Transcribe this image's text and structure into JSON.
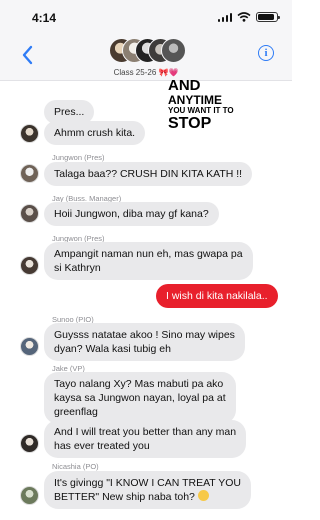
{
  "status_bar": {
    "time": "4:14"
  },
  "header": {
    "group_name": "Class 25-26",
    "group_emoji": "🎀💗",
    "back_icon": "chevron-left-icon",
    "info_icon": "info-icon",
    "info_glyph": "i"
  },
  "sticker": {
    "line1": "AND",
    "line2": "ANYTIME",
    "line3": "YOU WANT IT TO",
    "line4": "STOP"
  },
  "messages": [
    {
      "sender": "",
      "text": "Pres...",
      "direction": "in"
    },
    {
      "sender": "",
      "text": "Ahmm crush kita.",
      "direction": "in"
    },
    {
      "sender": "Jungwon (Pres)",
      "text": "Talaga baa?? CRUSH DIN KITA KATH !!",
      "direction": "in"
    },
    {
      "sender": "Jay (Buss. Manager)",
      "text": "Hoii Jungwon, diba may gf kana?",
      "direction": "in"
    },
    {
      "sender": "Jungwon (Pres)",
      "text_lines": [
        "Ampangit naman nun eh, mas gwapa pa",
        "si Kathryn"
      ],
      "direction": "in"
    },
    {
      "sender": "",
      "text": "I wish di kita nakilala..",
      "direction": "out"
    },
    {
      "sender": "Sunoo (PIO)",
      "text_lines": [
        "Guysss natatae akoo ! Sino may wipes",
        "dyan? Wala kasi tubig eh"
      ],
      "direction": "in"
    },
    {
      "sender": "Jake (VP)",
      "text_lines": [
        "Tayo nalang Xy? Mas mabuti pa ako",
        "kaysa sa Jungwon nayan, loyal pa at",
        "greenflag"
      ],
      "direction": "in"
    },
    {
      "sender": "",
      "text_lines": [
        "And I will treat you better than any man",
        "has ever treated you"
      ],
      "direction": "in"
    },
    {
      "sender": "Nicashia (PO)",
      "text_lines": [
        "It's givingg \"I KNOW I CAN TREAT YOU",
        "BETTER\" New ship naba toh? "
      ],
      "direction": "in"
    }
  ],
  "colors": {
    "accent": "#2f7cf6",
    "outgoing_bubble": "#e8202c",
    "incoming_bubble": "#e9e9eb"
  }
}
